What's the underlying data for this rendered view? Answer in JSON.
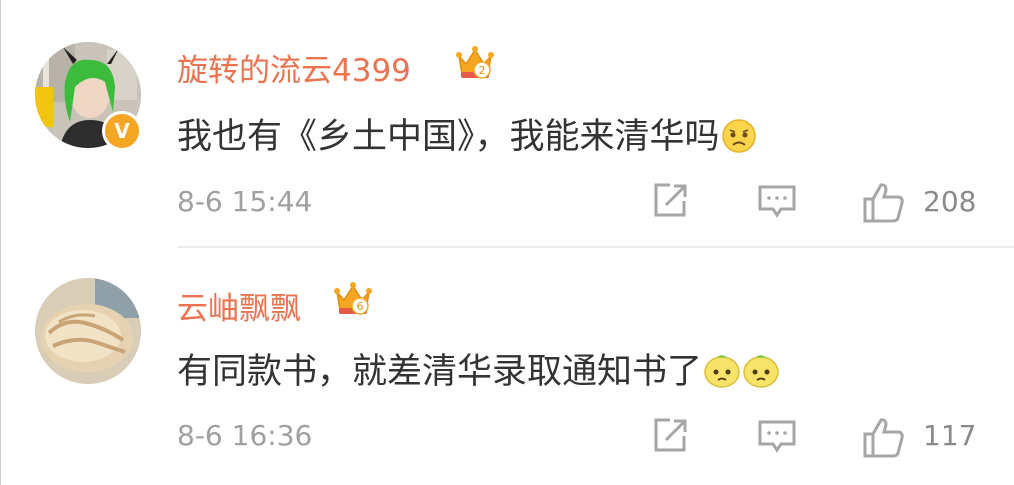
{
  "comments": [
    {
      "username": "旋转的流云4399",
      "verified_badge": "V",
      "crown_level": "2",
      "text": "我也有《乡土中国》，我能来清华吗",
      "emojis": [
        "sad-face-emoji"
      ],
      "time": "8-6 15:44",
      "likes": "208"
    },
    {
      "username": "云岫飘飘",
      "crown_level": "6",
      "text": "有同款书，就差清华录取通知书了",
      "emojis": [
        "lemon-face-emoji",
        "lemon-face-emoji"
      ],
      "time": "8-6 16:36",
      "likes": "117"
    }
  ],
  "colors": {
    "username": "#eb7350",
    "text": "#333333",
    "meta": "#a0a0a0",
    "crown": "#f5a623",
    "icon": "#a6a6a6"
  }
}
